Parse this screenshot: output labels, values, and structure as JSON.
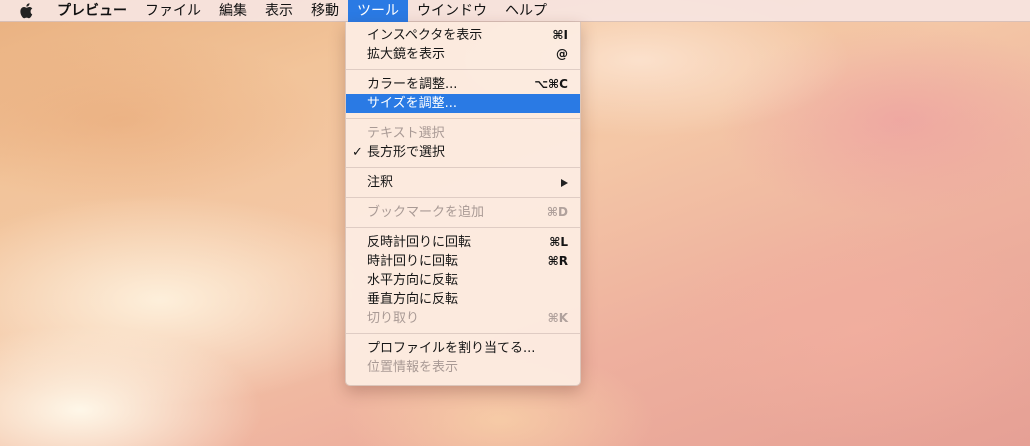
{
  "menubar": {
    "app_name": "プレビュー",
    "menus": [
      "ファイル",
      "編集",
      "表示",
      "移動",
      "ツール",
      "ウインドウ",
      "ヘルプ"
    ],
    "active_menu": "ツール"
  },
  "tools_menu": {
    "groups": [
      [
        {
          "label": "インスペクタを表示",
          "shortcut": "⌘I",
          "enabled": true
        },
        {
          "label": "拡大鏡を表示",
          "shortcut": "@",
          "enabled": true
        }
      ],
      [
        {
          "label": "カラーを調整...",
          "shortcut": "⌥⌘C",
          "enabled": true
        },
        {
          "label": "サイズを調整...",
          "shortcut": "",
          "enabled": true,
          "highlighted": true
        }
      ],
      [
        {
          "label": "テキスト選択",
          "shortcut": "",
          "enabled": false
        },
        {
          "label": "長方形で選択",
          "shortcut": "",
          "enabled": true,
          "checked": true,
          "check_mark": "✓"
        }
      ],
      [
        {
          "label": "注釈",
          "shortcut": "",
          "enabled": true,
          "submenu": true
        }
      ],
      [
        {
          "label": "ブックマークを追加",
          "shortcut": "⌘D",
          "enabled": false
        }
      ],
      [
        {
          "label": "反時計回りに回転",
          "shortcut": "⌘L",
          "enabled": true
        },
        {
          "label": "時計回りに回転",
          "shortcut": "⌘R",
          "enabled": true
        },
        {
          "label": "水平方向に反転",
          "shortcut": "",
          "enabled": true
        },
        {
          "label": "垂直方向に反転",
          "shortcut": "",
          "enabled": true
        },
        {
          "label": "切り取り",
          "shortcut": "⌘K",
          "enabled": false
        }
      ],
      [
        {
          "label": "プロファイルを割り当てる...",
          "shortcut": "",
          "enabled": true
        },
        {
          "label": "位置情報を表示",
          "shortcut": "",
          "enabled": false
        }
      ]
    ]
  },
  "icons": {
    "apple": "apple-logo-icon",
    "submenu": "chevron-right-icon",
    "check": "checkmark-icon"
  },
  "colors": {
    "highlight": "#2a7ae4",
    "disabled_text": "#a99a95"
  }
}
